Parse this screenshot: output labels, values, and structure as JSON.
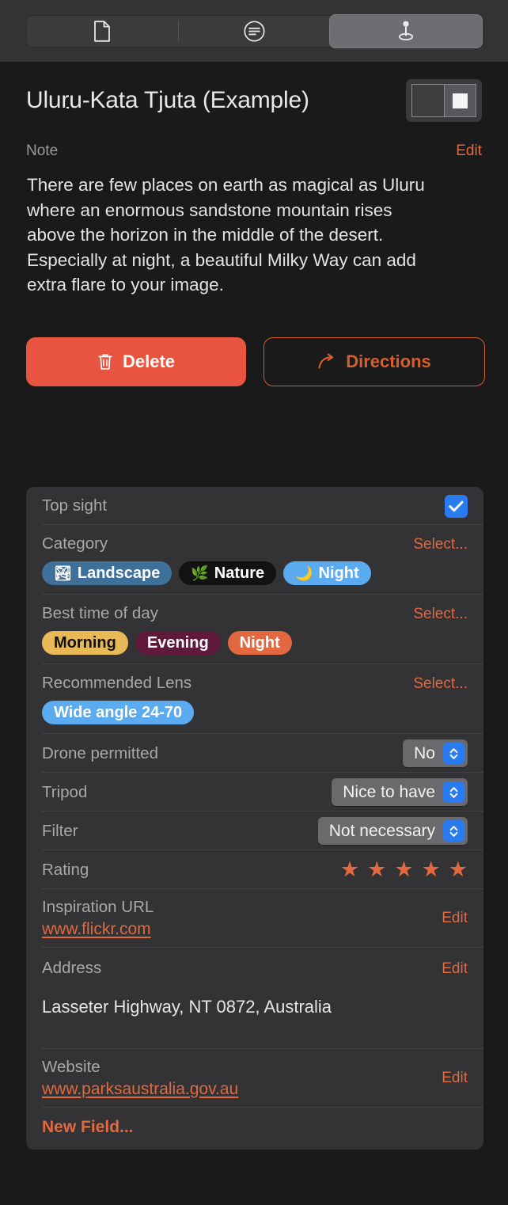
{
  "toolbar": {
    "tabs": [
      {
        "name": "document-tab",
        "icon": "document-icon",
        "active": false
      },
      {
        "name": "info-tab",
        "icon": "text-lines-circle-icon",
        "active": false
      },
      {
        "name": "location-tab",
        "icon": "map-pin-icon",
        "active": true
      }
    ]
  },
  "header": {
    "title_before": "Ulu",
    "title_macron_r": "r",
    "title_middle": "u-Kata Tju",
    "title_macron_t": "t",
    "title_after": "a (Example)",
    "title_full": "Uluṟu-Kata Tjuṯa (Example)",
    "view_toggle": {
      "name": "split-view-toggle",
      "selected": "right"
    }
  },
  "note": {
    "label": "Note",
    "edit_label": "Edit",
    "body": "There are few places on earth as magical as Uluru where an enormous sandstone mountain rises above the horizon in the middle of the desert. Especially at night, a beautiful Milky Way can add extra flare to your image."
  },
  "actions": {
    "delete_label": "Delete",
    "directions_label": "Directions"
  },
  "details": {
    "top_sight": {
      "label": "Top sight",
      "checked": true
    },
    "category": {
      "label": "Category",
      "select_label": "Select...",
      "chips": [
        {
          "emoji": "🏞",
          "label": "Landscape",
          "bg": "#3f7099",
          "fg": "#ffffff"
        },
        {
          "emoji": "🌿",
          "label": "Nature",
          "bg": "#121212",
          "fg": "#ffffff"
        },
        {
          "emoji": "🌙",
          "label": "Night",
          "bg": "#5aabef",
          "fg": "#ffffff"
        }
      ]
    },
    "best_time": {
      "label": "Best time of day",
      "select_label": "Select...",
      "chips": [
        {
          "label": "Morning",
          "bg": "#e8b954",
          "fg": "#101010"
        },
        {
          "label": "Evening",
          "bg": "#5e1a38",
          "fg": "#ffffff"
        },
        {
          "label": "Night",
          "bg": "#e2683f",
          "fg": "#ffffff"
        }
      ]
    },
    "lens": {
      "label": "Recommended Lens",
      "select_label": "Select...",
      "chips": [
        {
          "label": "Wide angle 24-70",
          "bg": "#5aabef",
          "fg": "#ffffff"
        }
      ]
    },
    "popups": [
      {
        "name": "drone-permitted",
        "label": "Drone permitted",
        "value": "No"
      },
      {
        "name": "tripod",
        "label": "Tripod",
        "value": "Nice to have"
      },
      {
        "name": "filter",
        "label": "Filter",
        "value": "Not necessary"
      }
    ],
    "rating": {
      "label": "Rating",
      "value": 5,
      "max": 5,
      "glyph": "★",
      "color": "#e2683f"
    },
    "inspiration_url": {
      "label": "Inspiration URL",
      "value": "www.flickr.com",
      "edit_label": "Edit"
    },
    "address": {
      "label": "Address",
      "value": "Lasseter Highway, NT 0872, Australia",
      "edit_label": "Edit"
    },
    "website": {
      "label": "Website",
      "value": "www.parksaustralia.gov.au",
      "edit_label": "Edit"
    },
    "new_field_label": "New Field..."
  },
  "colors": {
    "accent_orange": "#e2683f",
    "delete_red": "#e8543f",
    "blue": "#2a7bf0",
    "card_bg": "#333335",
    "page_bg": "#1a1a1a"
  }
}
